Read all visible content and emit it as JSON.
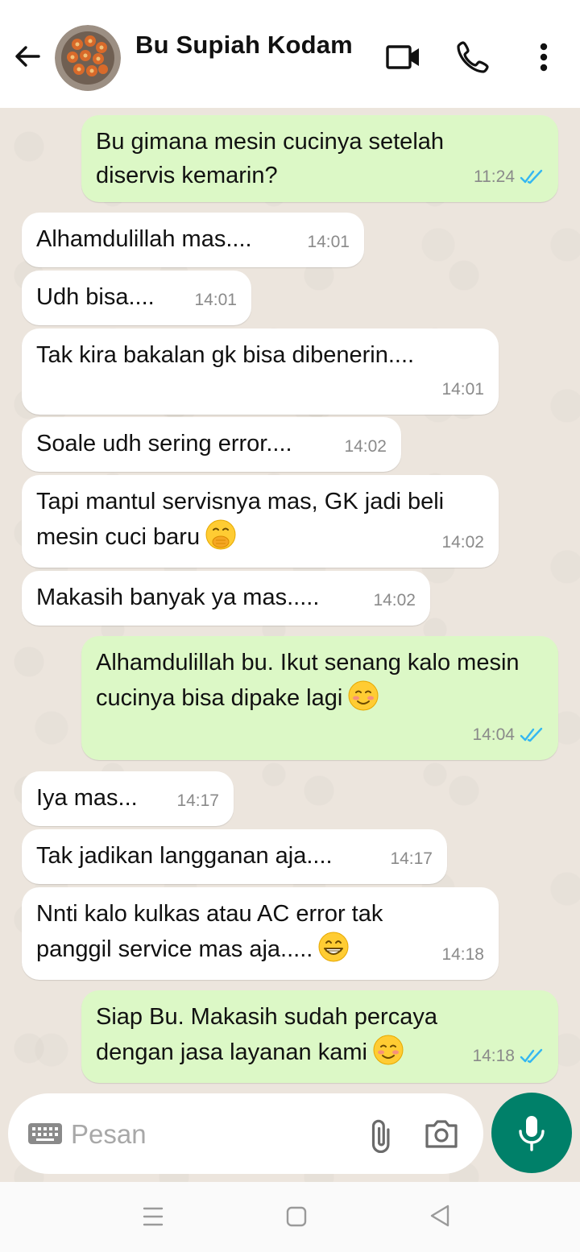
{
  "header": {
    "contact_name": "Bu Supiah Kodam",
    "icons": [
      "back-arrow-icon",
      "video-call-icon",
      "voice-call-icon",
      "more-vert-icon"
    ]
  },
  "messages": [
    {
      "direction": "out",
      "text": "Bu gimana mesin cucinya setelah diservis kemarin?",
      "time": "11:24",
      "status": "read"
    },
    {
      "direction": "in",
      "text": "Alhamdulillah mas....",
      "time": "14:01"
    },
    {
      "direction": "in",
      "text": "Udh bisa....",
      "time": "14:01"
    },
    {
      "direction": "in",
      "text": "Tak kira bakalan gk bisa dibenerin....",
      "time": "14:01"
    },
    {
      "direction": "in",
      "text": "Soale udh sering error....",
      "time": "14:02"
    },
    {
      "direction": "in",
      "text": "Tapi mantul servisnya mas, GK jadi beli mesin cuci baru",
      "emoji": "hand-over-mouth-emoji",
      "time": "14:02"
    },
    {
      "direction": "in",
      "text": "Makasih banyak ya mas.....",
      "time": "14:02"
    },
    {
      "direction": "out",
      "text": "Alhamdulillah bu. Ikut senang kalo mesin cucinya bisa dipake lagi",
      "emoji": "smiling-emoji",
      "time": "14:04",
      "status": "read"
    },
    {
      "direction": "in",
      "text": "Iya mas...",
      "time": "14:17"
    },
    {
      "direction": "in",
      "text": "Tak jadikan langganan aja....",
      "time": "14:17"
    },
    {
      "direction": "in",
      "text": "Nnti kalo kulkas atau AC error tak panggil service mas aja.....",
      "emoji": "grinning-emoji",
      "time": "14:18"
    },
    {
      "direction": "out",
      "text": "Siap Bu. Makasih sudah percaya dengan jasa layanan kami",
      "emoji": "smiling-emoji",
      "time": "14:18",
      "status": "read"
    }
  ],
  "composer": {
    "placeholder": "Pesan",
    "icons": [
      "keyboard-icon",
      "attach-icon",
      "camera-icon",
      "mic-icon"
    ]
  },
  "colors": {
    "outgoing_bubble": "#dcf8c6",
    "incoming_bubble": "#ffffff",
    "chat_background": "#ece5dd",
    "mic_button": "#008069",
    "read_ticks": "#34b7f1"
  }
}
